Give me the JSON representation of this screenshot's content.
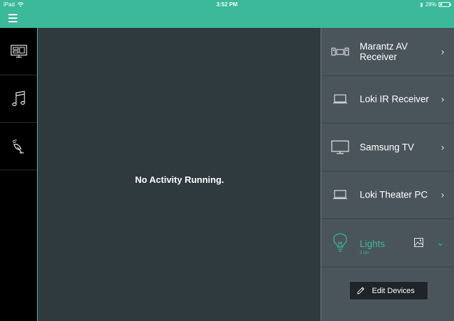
{
  "status_bar": {
    "carrier": "iPad",
    "time": "3:52 PM",
    "battery": "28%",
    "battery_level": 0.28
  },
  "header": {
    "menu_icon": "hamburger-menu-icon"
  },
  "left_nav": {
    "items": [
      {
        "icon": "tv-display-icon"
      },
      {
        "icon": "music-note-icon"
      },
      {
        "icon": "satellite-dish-icon"
      }
    ]
  },
  "main": {
    "message": "No Activity Running."
  },
  "devices": [
    {
      "name": "Marantz AV Receiver",
      "icon": "av-receiver-icon"
    },
    {
      "name": "Loki IR Receiver",
      "icon": "laptop-icon"
    },
    {
      "name": "Samsung TV",
      "icon": "tv-icon"
    },
    {
      "name": "Loki Theater PC",
      "icon": "laptop-icon"
    }
  ],
  "lights": {
    "name": "Lights",
    "sub": "3 On",
    "icon": "lightbulb-icon",
    "scene_icon": "scene-image-icon",
    "accent": "#3bb99a"
  },
  "edit_button": {
    "label": "Edit Devices",
    "icon": "pencil-icon"
  },
  "colors": {
    "accent": "#3bb99a",
    "main_bg": "#2f3a3f",
    "panel_bg": "#4a555b",
    "nav_bg": "#000000"
  }
}
